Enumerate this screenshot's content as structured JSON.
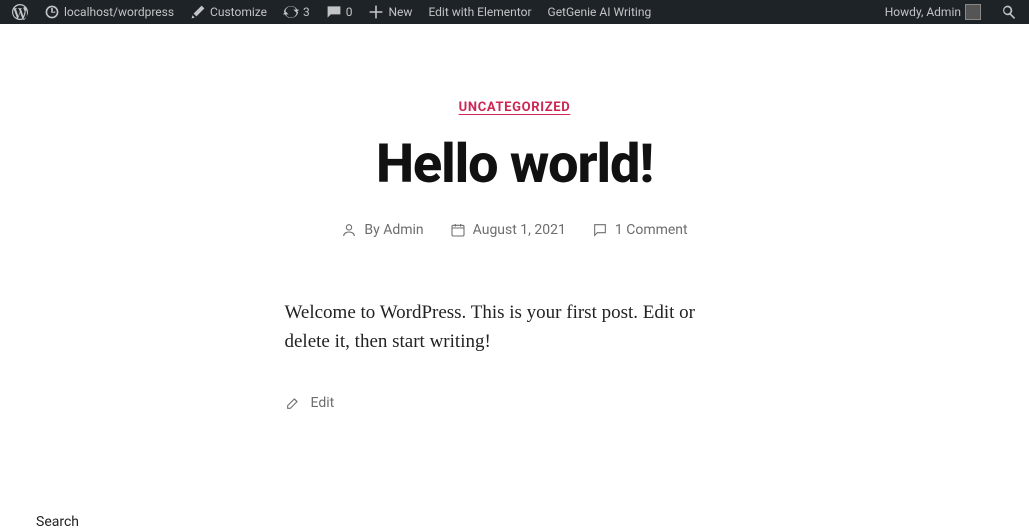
{
  "adminbar": {
    "site_name": "localhost/wordpress",
    "customize": "Customize",
    "updates_count": "3",
    "comments_count": "0",
    "new_label": "New",
    "edit_elementor": "Edit with Elementor",
    "getgenie": "GetGenie AI Writing",
    "howdy": "Howdy, Admin"
  },
  "post": {
    "category": "Uncategorized",
    "title": "Hello world!",
    "author_prefix": "By ",
    "author": "Admin",
    "date": "August 1, 2021",
    "comments": "1 Comment",
    "body": "Welcome to WordPress. This is your first post. Edit or delete it, then start writing!",
    "edit_label": "Edit"
  },
  "footer": {
    "search_label": "Search"
  }
}
